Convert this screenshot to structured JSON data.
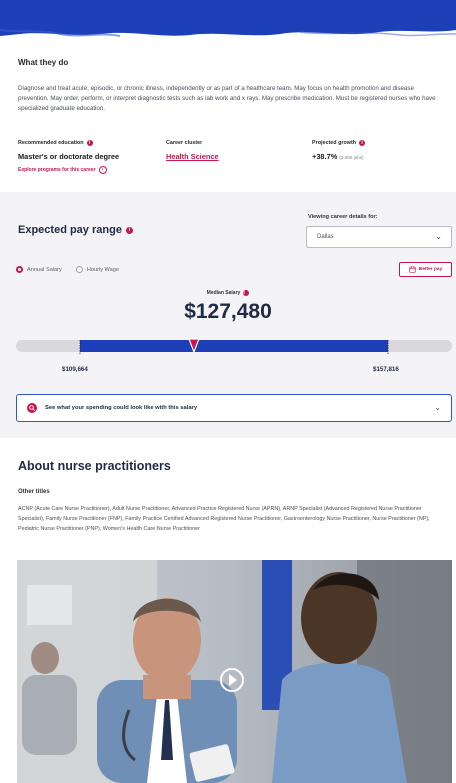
{
  "section_what": {
    "title": "What they do",
    "description": "Diagnose and treat acute, episodic, or chronic illness, independently or as part of a healthcare team. May focus on health promotion and disease prevention. May order, perform, or interpret diagnostic tests such as lab work and x rays. May prescribe medication. Must be registered nurses who have specialized graduate education."
  },
  "facts": {
    "education": {
      "label": "Recommended education",
      "value": "Master's or doctorate degree",
      "link": "Explore programs for this career"
    },
    "cluster": {
      "label": "Career cluster",
      "value": "Health Science"
    },
    "growth": {
      "label": "Projected growth",
      "value": "+38.7%",
      "sub": "(3,660 jobs)"
    }
  },
  "pay": {
    "title": "Expected pay range",
    "viewing_label": "Viewing career details for:",
    "location": "Dallas",
    "radio_annual": "Annual Salary",
    "radio_hourly": "Hourly Wage",
    "selected": "annual",
    "better_pay_label": "Better pay",
    "median_label": "Median Salary",
    "median_value": "$127,480",
    "low_value": "$109,664",
    "high_value": "$157,816",
    "range_min": 109664,
    "range_max": 157816,
    "median": 127480,
    "spend_text": "See what your spending could look like with this salary"
  },
  "about": {
    "title": "About nurse practitioners",
    "other_titles_label": "Other titles",
    "other_titles": "ACNP (Acute Care Nurse Practitioner), Adult Nurse Practitioner, Advanced Practice Registered Nurse (APRN), ARNP Specialist (Advanced Registered Nurse Practitioner Specialist), Family Nurse Practitioner (FNP), Family Practice Certified Advanced Registered Nurse Practitioner, Gastroenterology Nurse Practitioner, Nurse Practitioner (NP), Pediatric Nurse Practitioner (PNP), Women's Health Care Nurse Practitioner"
  },
  "colors": {
    "brand_blue": "#1d3fb8",
    "accent_pink": "#c6164f",
    "navy": "#1f2a44"
  }
}
